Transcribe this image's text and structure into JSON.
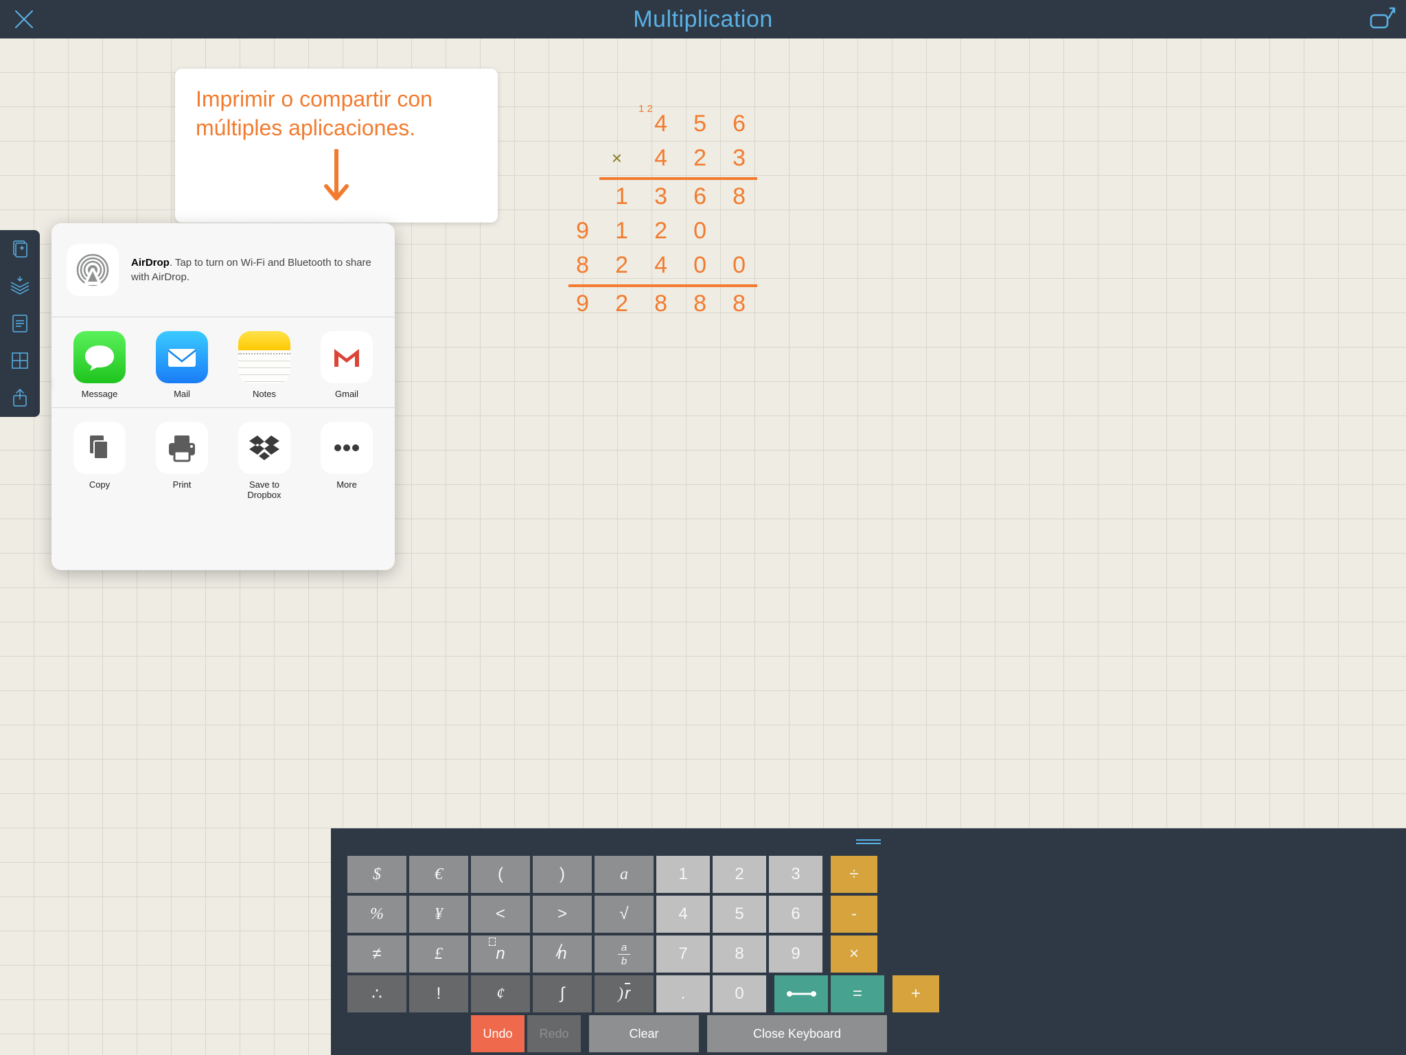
{
  "header": {
    "title": "Multiplication"
  },
  "callout": {
    "line1": "Imprimir o compartir con",
    "line2": "múltiples aplicaciones."
  },
  "airdrop": {
    "bold": "AirDrop",
    "rest": ". Tap to turn on Wi-Fi and Bluetooth to share with AirDrop."
  },
  "share_apps": [
    {
      "label": "Message"
    },
    {
      "label": "Mail"
    },
    {
      "label": "Notes"
    },
    {
      "label": "Gmail"
    }
  ],
  "share_actions": [
    {
      "label": "Copy"
    },
    {
      "label": "Print"
    },
    {
      "label": "Save to Dropbox"
    },
    {
      "label": "More"
    }
  ],
  "math": {
    "carry": "1 2",
    "r1": [
      "",
      "4",
      "5",
      "6"
    ],
    "r2": [
      "×",
      "4",
      "2",
      "3"
    ],
    "r3": [
      "1",
      "3",
      "6",
      "8"
    ],
    "r4": [
      "",
      "9",
      "1",
      "2",
      "0"
    ],
    "r5": [
      "8",
      "2",
      "4",
      "0",
      "0"
    ],
    "r6": [
      "9",
      "2",
      "8",
      "8",
      "8"
    ]
  },
  "keyboard": {
    "rows": [
      [
        "$",
        "€",
        "(",
        ")",
        "a",
        "1",
        "2",
        "3",
        "÷"
      ],
      [
        "%",
        "¥",
        "<",
        ">",
        "√",
        "4",
        "5",
        "6",
        "-"
      ],
      [
        "≠",
        "£",
        "ⁿn",
        "n̸",
        "a/b",
        "7",
        "8",
        "9",
        "×"
      ],
      [
        "∴",
        "!",
        "¢",
        "∫",
        "√r",
        ".",
        "0",
        "⟶",
        "=",
        "+"
      ]
    ],
    "actions": {
      "undo": "Undo",
      "redo": "Redo",
      "clear": "Clear",
      "close": "Close Keyboard"
    }
  }
}
